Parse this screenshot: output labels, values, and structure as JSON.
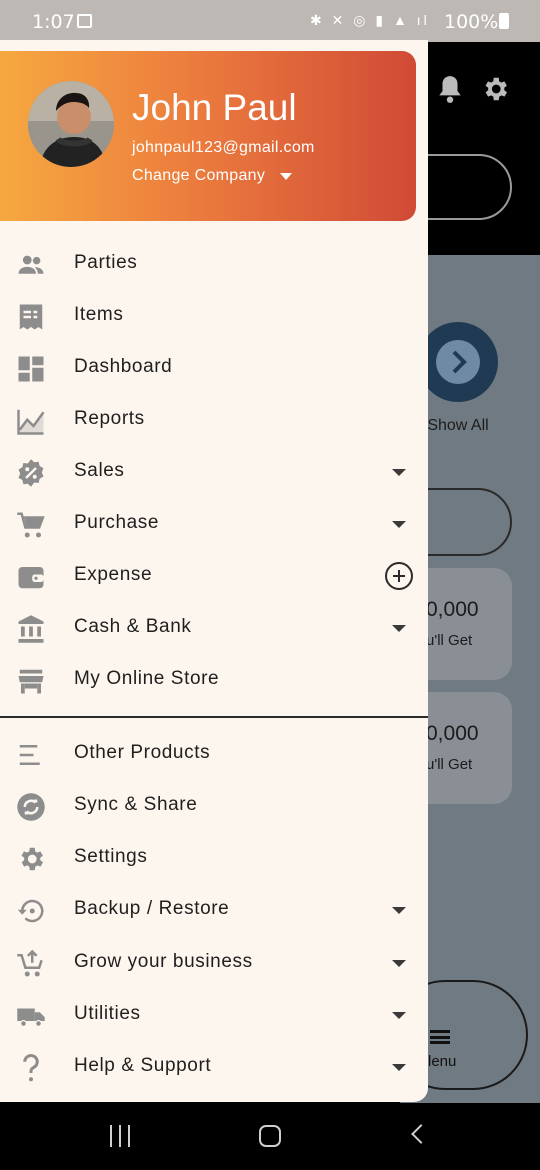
{
  "status_bar": {
    "time": "1:07",
    "battery": "100%"
  },
  "profile": {
    "name": "John Paul",
    "email": "johnpaul123@gmail.com",
    "change_company": "Change Company"
  },
  "menu": {
    "items": [
      {
        "label": "Parties",
        "icon": "people-icon",
        "trailing": "none"
      },
      {
        "label": "Items",
        "icon": "receipt-icon",
        "trailing": "none"
      },
      {
        "label": "Dashboard",
        "icon": "dashboard-icon",
        "trailing": "none"
      },
      {
        "label": "Reports",
        "icon": "chart-icon",
        "trailing": "none"
      },
      {
        "label": "Sales",
        "icon": "discount-icon",
        "trailing": "expand"
      },
      {
        "label": "Purchase",
        "icon": "cart-icon",
        "trailing": "expand"
      },
      {
        "label": "Expense",
        "icon": "wallet-icon",
        "trailing": "add"
      },
      {
        "label": "Cash & Bank",
        "icon": "bank-icon",
        "trailing": "expand"
      },
      {
        "label": "My Online Store",
        "icon": "store-icon",
        "trailing": "none"
      }
    ],
    "secondary_items": [
      {
        "label": "Other Products",
        "icon": "list-icon",
        "trailing": "none"
      },
      {
        "label": "Sync & Share",
        "icon": "sync-icon",
        "trailing": "none"
      },
      {
        "label": "Settings",
        "icon": "gear-icon",
        "trailing": "none"
      },
      {
        "label": "Backup / Restore",
        "icon": "restore-icon",
        "trailing": "expand"
      },
      {
        "label": "Grow your business",
        "icon": "cart-upload-icon",
        "trailing": "expand"
      },
      {
        "label": "Utilities",
        "icon": "truck-icon",
        "trailing": "expand"
      },
      {
        "label": "Help & Support",
        "icon": "question-icon",
        "trailing": "expand"
      }
    ]
  },
  "background_app": {
    "show_all": "Show All",
    "card1_amount": "0,000",
    "card1_sub": "u'll Get",
    "card2_amount": "0,000",
    "card2_sub": "u'll Get",
    "menu_label": "lenu"
  },
  "colors": {
    "header_start": "#f6a840",
    "header_end": "#d04a36",
    "drawer_bg": "#fdf6ee",
    "icon_gray": "#8d8d8d"
  }
}
